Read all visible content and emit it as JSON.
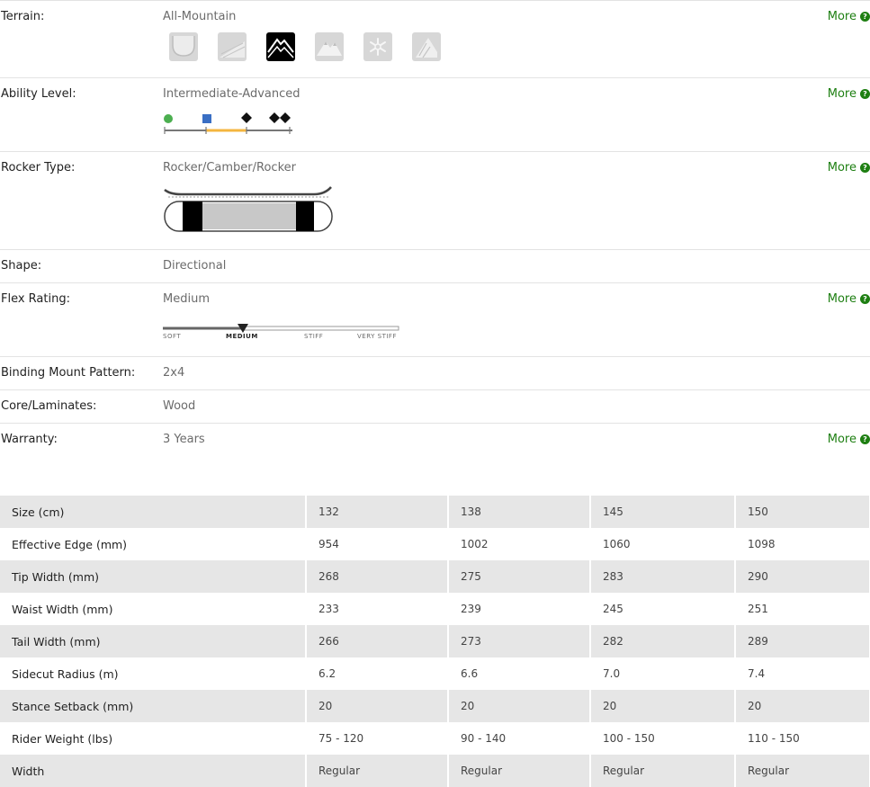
{
  "more_label": "More",
  "specs": {
    "terrain": {
      "label": "Terrain:",
      "value": "All-Mountain",
      "icons": [
        "park-pipe-icon",
        "freeride-icon",
        "all-mountain-icon",
        "backcountry-icon",
        "powder-icon",
        "groomers-icon"
      ],
      "active_index": 2
    },
    "ability": {
      "label": "Ability Level:",
      "value": "Intermediate-Advanced",
      "levels": [
        "beginner-circle",
        "intermediate-square",
        "advanced-diamond",
        "expert-double-diamond"
      ],
      "highlight_range": [
        "intermediate",
        "advanced"
      ],
      "highlight_color": "#f4b63f"
    },
    "rocker": {
      "label": "Rocker Type:",
      "value": "Rocker/Camber/Rocker"
    },
    "shape": {
      "label": "Shape:",
      "value": "Directional"
    },
    "flex": {
      "label": "Flex Rating:",
      "value": "Medium",
      "scale": [
        "SOFT",
        "MEDIUM",
        "STIFF",
        "VERY STIFF"
      ],
      "selected": "MEDIUM"
    },
    "binding": {
      "label": "Binding Mount Pattern:",
      "value": "2x4"
    },
    "core": {
      "label": "Core/Laminates:",
      "value": "Wood"
    },
    "warranty": {
      "label": "Warranty:",
      "value": "3 Years"
    }
  },
  "size_table": {
    "rows": [
      [
        "Size (cm)",
        "132",
        "138",
        "145",
        "150"
      ],
      [
        "Effective Edge (mm)",
        "954",
        "1002",
        "1060",
        "1098"
      ],
      [
        "Tip Width (mm)",
        "268",
        "275",
        "283",
        "290"
      ],
      [
        "Waist Width (mm)",
        "233",
        "239",
        "245",
        "251"
      ],
      [
        "Tail Width (mm)",
        "266",
        "273",
        "282",
        "289"
      ],
      [
        "Sidecut Radius (m)",
        "6.2",
        "6.6",
        "7.0",
        "7.4"
      ],
      [
        "Stance Setback (mm)",
        "20",
        "20",
        "20",
        "20"
      ],
      [
        "Rider Weight (lbs)",
        "75 - 120",
        "90 - 140",
        "100 - 150",
        "110 - 150"
      ],
      [
        "Width",
        "Regular",
        "Regular",
        "Regular",
        "Regular"
      ]
    ]
  },
  "colors": {
    "link_green": "#1e7f12",
    "table_stripe": "#e6e6e6",
    "ability_bar": "#f4b63f"
  }
}
